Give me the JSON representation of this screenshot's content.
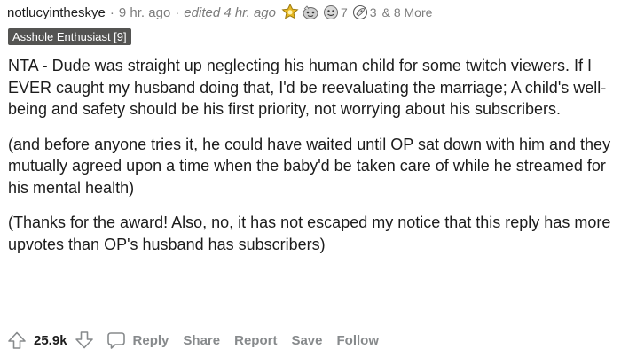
{
  "comment": {
    "username": "notlucyintheskye",
    "time_posted": "9 hr. ago",
    "edited": "edited 4 hr. ago",
    "separator": "·",
    "awards": [
      {
        "icon": "gold-medal-icon",
        "count": ""
      },
      {
        "icon": "wholesome-icon",
        "count": ""
      },
      {
        "icon": "helpful-icon",
        "count": "7"
      },
      {
        "icon": "rocket-icon",
        "count": "3"
      }
    ],
    "more_awards": "& 8 More",
    "flair": "Asshole Enthusiast [9]",
    "paragraphs": [
      "NTA - Dude was straight up neglecting his human child for some twitch viewers. If I EVER caught my husband doing that, I'd be reevaluating the marriage; A child's well-being and safety should be his first priority, not worrying about his subscribers.",
      "(and before anyone tries it, he could have waited until OP sat down with him and they mutually agreed upon a time when the baby'd be taken care of while he streamed for his mental health)",
      "(Thanks for the award! Also, no, it has not escaped my notice that this reply has more upvotes than OP's husband has subscribers)"
    ]
  },
  "actions": {
    "score": "25.9k",
    "reply": "Reply",
    "share": "Share",
    "report": "Report",
    "save": "Save",
    "follow": "Follow"
  },
  "colors": {
    "text": "#1c1c1c",
    "muted": "#7c7c7c",
    "action": "#878a8c",
    "flair_bg": "#545452",
    "award_gold": "#e8b923"
  }
}
